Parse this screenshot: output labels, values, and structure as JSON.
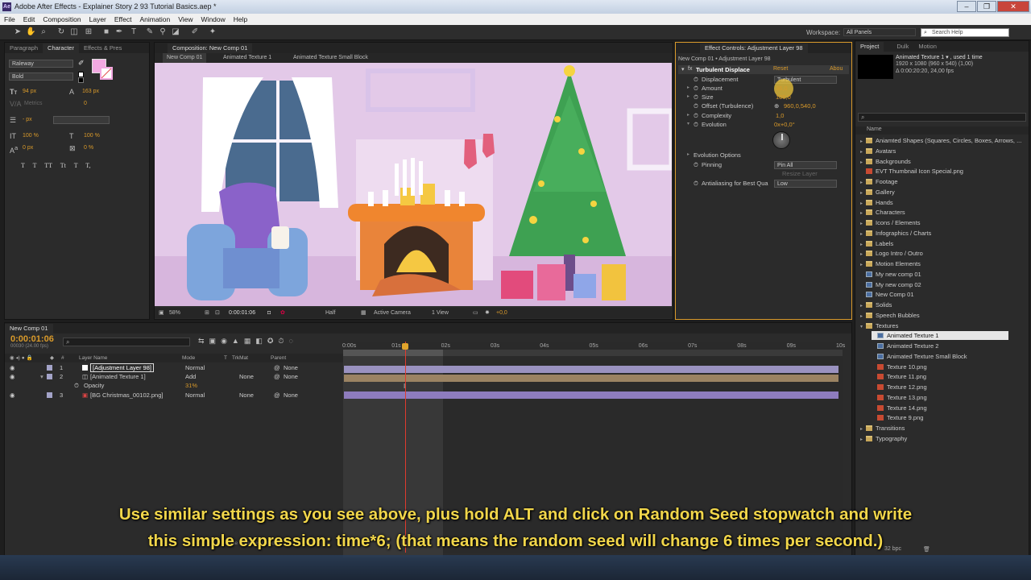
{
  "app": {
    "title": "Adobe After Effects - Explainer Story 2 93 Tutorial Basics.aep *",
    "icon_text": "Ae"
  },
  "window_buttons": [
    "–",
    "❐",
    "✕"
  ],
  "menu": [
    "File",
    "Edit",
    "Composition",
    "Layer",
    "Effect",
    "Animation",
    "View",
    "Window",
    "Help"
  ],
  "toolbar": {
    "workspace_label": "Workspace:",
    "workspace_value": "All Panels",
    "search_placeholder": "Search Help"
  },
  "character_panel": {
    "tabs": [
      "Paragraph",
      "Character",
      "Effects & Pres"
    ],
    "font": "Raleway",
    "style": "Bold",
    "font_size": "94 px",
    "leading": "163 px",
    "tracking_label": "Metrics",
    "tracking_value": "0",
    "stroke": "- px",
    "vscale": "100 %",
    "hscale": "100 %",
    "baseline": "0 px",
    "tsume": "0 %",
    "fill_color": "#f3a9e2",
    "text_buttons": [
      "T",
      "T",
      "TT",
      "Tt",
      "T",
      "T,"
    ]
  },
  "composition": {
    "tab": "Composition: New Comp 01",
    "breadcrumbs": [
      "New Comp 01",
      "Animated Texture 1",
      "Animated Texture Small Block"
    ],
    "zoom": "58%",
    "time": "0:00:01:06",
    "resolution": "Half",
    "camera": "Active Camera",
    "view": "1 View",
    "exposure": "+0,0"
  },
  "effect_controls": {
    "tab": "Effect Controls: Adjustment Layer 98",
    "path": "New Comp 01 • Adjustment Layer 98",
    "effect": "Turbulent Displace",
    "reset": "Reset",
    "about": "Abou",
    "props": [
      {
        "name": "Displacement",
        "value": "Turbulent"
      },
      {
        "name": "Amount",
        "value": "36,0"
      },
      {
        "name": "Size",
        "value": "100,0"
      },
      {
        "name": "Offset (Turbulence)",
        "value": "960,0,540,0"
      },
      {
        "name": "Complexity",
        "value": "1,0"
      },
      {
        "name": "Evolution",
        "value": "0x+0,0°"
      }
    ],
    "evolution_options": "Evolution Options",
    "pinning": "Pinning",
    "pinning_value": "Pin All",
    "resize": "Resize Layer",
    "antialias": "Antialiasing for Best Qua",
    "antialias_value": "Low"
  },
  "project": {
    "tabs": [
      "Project",
      "Dulk",
      "Motion"
    ],
    "selected_name": "Animated Texture 1 ▾ , used 1 time",
    "dims": "1920 x 1080 (960 x 540) (1,00)",
    "duration": "Δ 0:00:20:20, 24,00 fps",
    "name_header": "Name",
    "items": [
      {
        "label": "Aniamted Shapes (Squares, Circles, Boxes, Arrows, ...",
        "type": "folder",
        "indent": 0
      },
      {
        "label": "Avatars",
        "type": "folder",
        "indent": 0
      },
      {
        "label": "Backgrounds",
        "type": "folder",
        "indent": 0
      },
      {
        "label": "EVT Thumbnail Icon Special.png",
        "type": "png",
        "indent": 0
      },
      {
        "label": "Footage",
        "type": "folder",
        "indent": 0
      },
      {
        "label": "Gallery",
        "type": "folder",
        "indent": 0
      },
      {
        "label": "Hands",
        "type": "folder",
        "indent": 0
      },
      {
        "label": "Characters",
        "type": "folder",
        "indent": 0
      },
      {
        "label": "Icons / Elements",
        "type": "folder",
        "indent": 0
      },
      {
        "label": "Infographics / Charts",
        "type": "folder",
        "indent": 0
      },
      {
        "label": "Labels",
        "type": "folder",
        "indent": 0
      },
      {
        "label": "Logo Intro / Outro",
        "type": "folder",
        "indent": 0
      },
      {
        "label": "Motion Elements",
        "type": "folder",
        "indent": 0
      },
      {
        "label": "My new comp 01",
        "type": "comp",
        "indent": 0
      },
      {
        "label": "My new comp 02",
        "type": "comp",
        "indent": 0
      },
      {
        "label": "New Comp 01",
        "type": "comp",
        "indent": 0
      },
      {
        "label": "Solids",
        "type": "folder",
        "indent": 0
      },
      {
        "label": "Speech Bubbles",
        "type": "folder",
        "indent": 0
      },
      {
        "label": "Textures",
        "type": "folder",
        "indent": 0
      },
      {
        "label": "Animated Texture 1",
        "type": "comp",
        "indent": 1
      },
      {
        "label": "Animated Texture 2",
        "type": "comp",
        "indent": 1
      },
      {
        "label": "Animated Texture Small Block",
        "type": "comp",
        "indent": 1
      },
      {
        "label": "Texture 10.png",
        "type": "png",
        "indent": 1
      },
      {
        "label": "Texture 11.png",
        "type": "png",
        "indent": 1
      },
      {
        "label": "Texture 12.png",
        "type": "png",
        "indent": 1
      },
      {
        "label": "Texture 13.png",
        "type": "png",
        "indent": 1
      },
      {
        "label": "Texture 14.png",
        "type": "png",
        "indent": 1
      },
      {
        "label": "Texture 9.png",
        "type": "png",
        "indent": 1
      },
      {
        "label": "Transitions",
        "type": "folder",
        "indent": 0
      },
      {
        "label": "Typography",
        "type": "folder",
        "indent": 0
      }
    ],
    "bpc": "32 bpc"
  },
  "timeline": {
    "tab": "New Comp 01",
    "time": "0:00:01:06",
    "frames": "00030 (24.00 fps)",
    "headers": {
      "name": "Layer Name",
      "mode": "Mode",
      "t": "T",
      "trkmat": "TrkMat",
      "parent": "Parent"
    },
    "layers": [
      {
        "num": "1",
        "name": "[Adjustment Layer 98]",
        "mode": "Normal",
        "trkmat": "",
        "parent": "None"
      },
      {
        "num": "2",
        "name": "[Animated Texture 1]",
        "mode": "Add",
        "trkmat": "None",
        "parent": "None"
      },
      {
        "num": "3",
        "name": "[BG Christmas_00102.png]",
        "mode": "Normal",
        "trkmat": "None",
        "parent": "None"
      }
    ],
    "opacity_label": "Opacity",
    "opacity_value": "31%",
    "ticks": [
      "0:00s",
      "01s",
      "02s",
      "03s",
      "04s",
      "05s",
      "06s",
      "07s",
      "08s",
      "09s",
      "10s"
    ],
    "footer": "Toggle Switches / Modes"
  },
  "caption": {
    "line1": "Use similar settings as you see above, plus hold ALT and click on Random Seed stopwatch and write",
    "line2": "this simple expression:  time*6;  (that means the random seed will change 6 times per second.)"
  }
}
